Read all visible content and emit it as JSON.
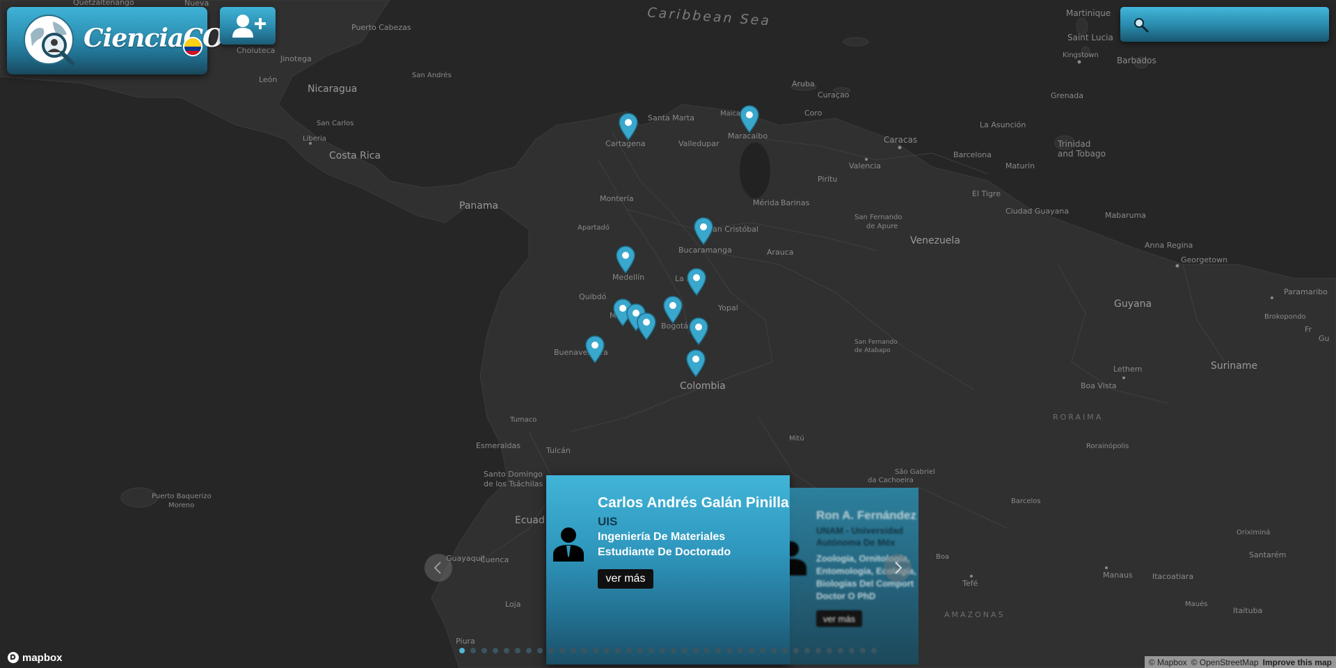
{
  "app": {
    "logo_text": "CienciaCO",
    "flag_colors": [
      "#fcd116",
      "#003893",
      "#ce1126"
    ]
  },
  "toolbar": {
    "add_user_icon": "user-plus-icon"
  },
  "search": {
    "placeholder": "",
    "icon": "search-icon"
  },
  "map": {
    "sea_label": "Caribbean Sea",
    "labels": {
      "countries": [
        "Nicaragua",
        "Costa Rica",
        "Panama",
        "Colombia",
        "Venezuela",
        "Guyana",
        "Suriname",
        "Ecuador"
      ],
      "regions": [
        "RORAIMA",
        "AMAZONAS"
      ],
      "cities": [
        "Quetzaltenango",
        "Nueva",
        "Puerto Cabezas",
        "Choluteca",
        "Jinotega",
        "León",
        "San Andrés",
        "Liberia",
        "San Carlos",
        "Santa Marta",
        "Valledupar",
        "Cartagena",
        "Maicao",
        "Maracaibo",
        "Aruba",
        "Curaçao",
        "Coro",
        "Caracas",
        "Barcelona",
        "Valencia",
        "Mérida",
        "Barinas",
        "Pirítu",
        "Montería",
        "Apartadó",
        "San Cristóbal",
        "Bucaramanga",
        "Arauca",
        "La Paz",
        "Medellín",
        "Quibdó",
        "Yopal",
        "Manizales",
        "Bogotá",
        "Buenaventura",
        "Tumaco",
        "Esmeraldas",
        "Tulcán",
        "Santo Domingo de los Tsáchilas",
        "Guayaquil",
        "Loja",
        "Piura",
        "Cuenca",
        "Mitú",
        "San Fernando de Apure",
        "San Fernando de Atabapo",
        "El Tigre",
        "Ciudad Guayana",
        "Maturín",
        "Trinidad and Tobago",
        "Grenada",
        "La Asunción",
        "Barbados",
        "Martinique",
        "Saint Lucia",
        "Kingstown",
        "Anna Regina",
        "Georgetown",
        "Paramaribo",
        "Mabaruma",
        "Lethem",
        "Boa Vista",
        "Rorainópolis",
        "Brokopondo",
        "Barcelos",
        "Manaus",
        "Itacoatiara",
        "Santarém",
        "Tefé",
        "Itaituba",
        "Oriximiná",
        "Maués",
        "São Gabriel da Cachoeira",
        "Puerto Baquerizo Moreno"
      ]
    },
    "marker_count": 12
  },
  "carousel": {
    "cards": [
      {
        "name": "Carlos Andrés Galán Pinilla",
        "institution": "UIS",
        "field": "Ingeniería De Materiales",
        "level": "Estudiante De Doctorado",
        "button": "ver más"
      },
      {
        "name": "Ron A. Fernández",
        "institution": "UNAM - Universidad",
        "institution2": "Autónoma De Méx",
        "field": "Zoología, Ornitología,",
        "field2": "Entomología, Ecología,",
        "field3": "Biologías Del Comport",
        "level": "Doctor O PhD",
        "button": "ver más"
      }
    ],
    "prev_icon": "chevron-left-icon",
    "next_icon": "chevron-right-icon",
    "active_dot": 0,
    "dot_count": 38
  },
  "footer": {
    "mapbox_logo": "mapbox",
    "attribution_mapbox": "© Mapbox",
    "attribution_osm": "© OpenStreetMap",
    "improve": "Improve this map"
  }
}
